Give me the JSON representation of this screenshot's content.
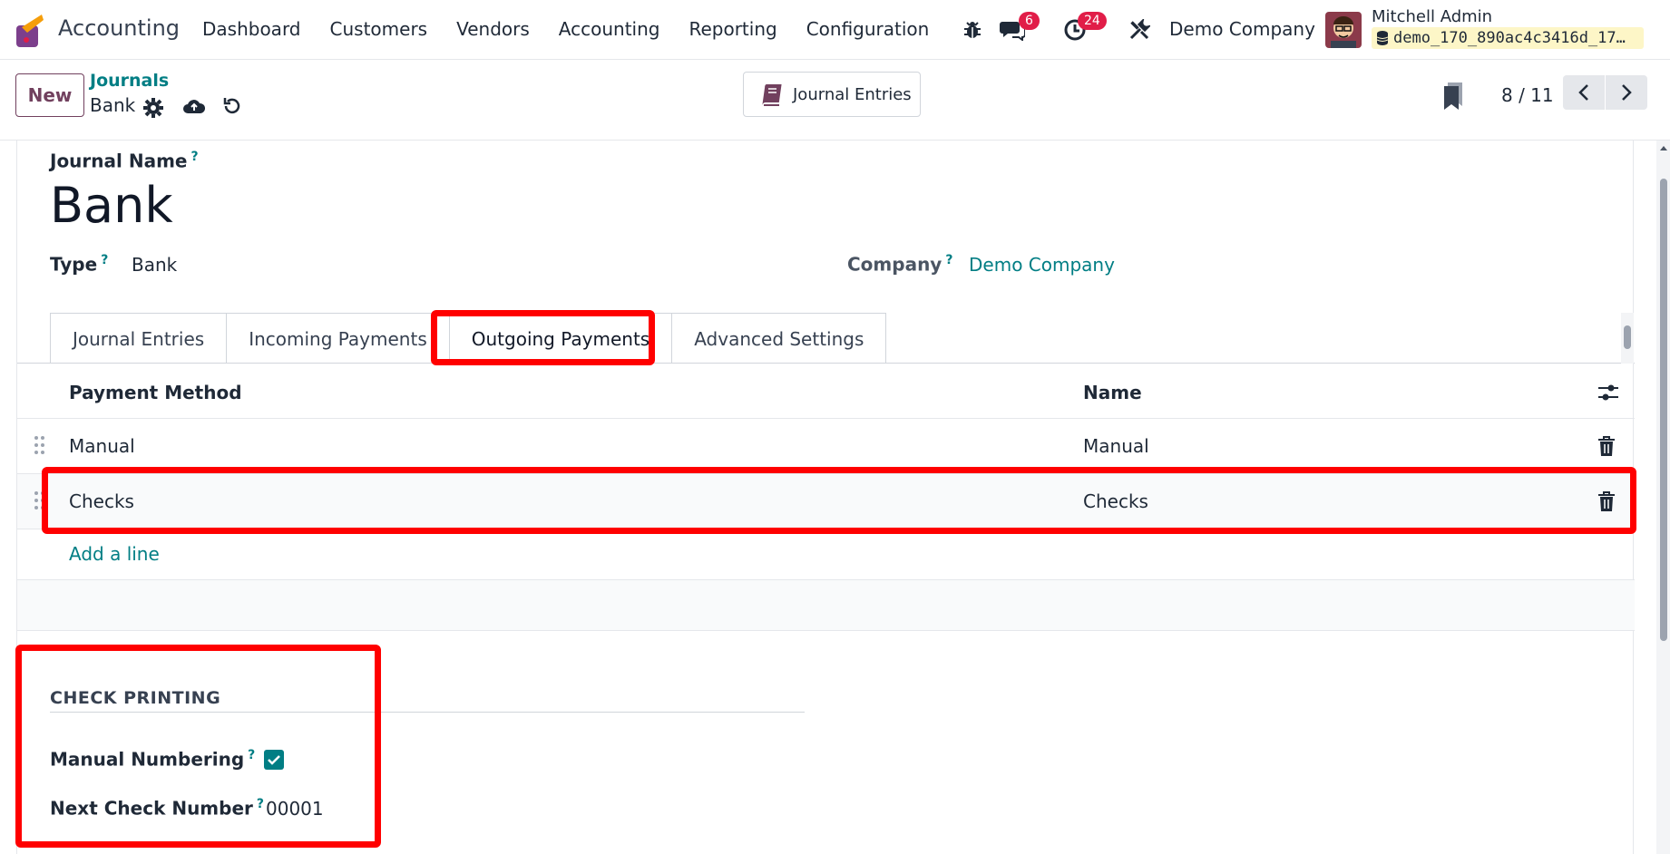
{
  "navbar": {
    "app_name": "Accounting",
    "menu": [
      "Dashboard",
      "Customers",
      "Vendors",
      "Accounting",
      "Reporting",
      "Configuration"
    ],
    "messages_badge": "6",
    "activities_badge": "24",
    "company": "Demo Company",
    "user_name": "Mitchell Admin",
    "database": "demo_170_890ac4c3416d_17…"
  },
  "control_panel": {
    "new_label": "New",
    "breadcrumb_parent": "Journals",
    "breadcrumb_current": "Bank",
    "smart_button_label": "Journal Entries",
    "pager": "8 / 11"
  },
  "form": {
    "journal_name_label": "Journal Name",
    "journal_name_value": "Bank",
    "type_label": "Type",
    "type_value": "Bank",
    "company_label": "Company",
    "company_value": "Demo Company",
    "help_mark": "?",
    "tabs": [
      "Journal Entries",
      "Incoming Payments",
      "Outgoing Payments",
      "Advanced Settings"
    ],
    "active_tab": "Outgoing Payments",
    "table": {
      "columns": [
        "Payment Method",
        "Name"
      ],
      "rows": [
        {
          "method": "Manual",
          "name": "Manual"
        },
        {
          "method": "Checks",
          "name": "Checks"
        }
      ],
      "add_line": "Add a line"
    },
    "check_printing": {
      "title": "CHECK PRINTING",
      "manual_numbering_label": "Manual Numbering",
      "manual_numbering_checked": true,
      "next_check_number_label": "Next Check Number",
      "next_check_number_value": "00001"
    }
  },
  "colors": {
    "brand": "#71405e",
    "link": "#017e84",
    "badge": "#e11d48",
    "annotation": "#ff0000"
  }
}
